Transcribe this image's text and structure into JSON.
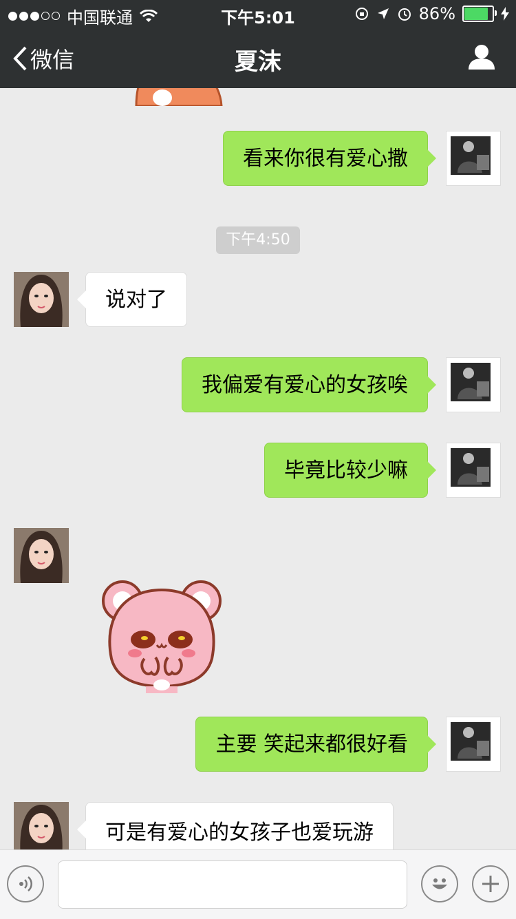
{
  "status_bar": {
    "carrier": "中国联通",
    "time": "下午5:01",
    "battery": "86%",
    "battery_level": 0.86
  },
  "nav": {
    "back_label": "微信",
    "title": "夏沫"
  },
  "timestamp": "下午4:50",
  "messages": [
    {
      "from": "me",
      "text": "看来你很有爱心撒"
    },
    {
      "from": "them",
      "text": "说对了"
    },
    {
      "from": "me",
      "text": "我偏爱有爱心的女孩唉"
    },
    {
      "from": "me",
      "text": "毕竟比较少嘛"
    },
    {
      "from": "them",
      "sticker": "pink-bear-sticker"
    },
    {
      "from": "me",
      "text": "主要 笑起来都很好看"
    },
    {
      "from": "them",
      "text": "可是有爱心的女孩子也爱玩游"
    }
  ],
  "input_bar": {
    "placeholder": ""
  },
  "colors": {
    "header": "#2e3132",
    "my_bubble": "#a0e75a",
    "their_bubble": "#ffffff",
    "background": "#ebebeb"
  }
}
